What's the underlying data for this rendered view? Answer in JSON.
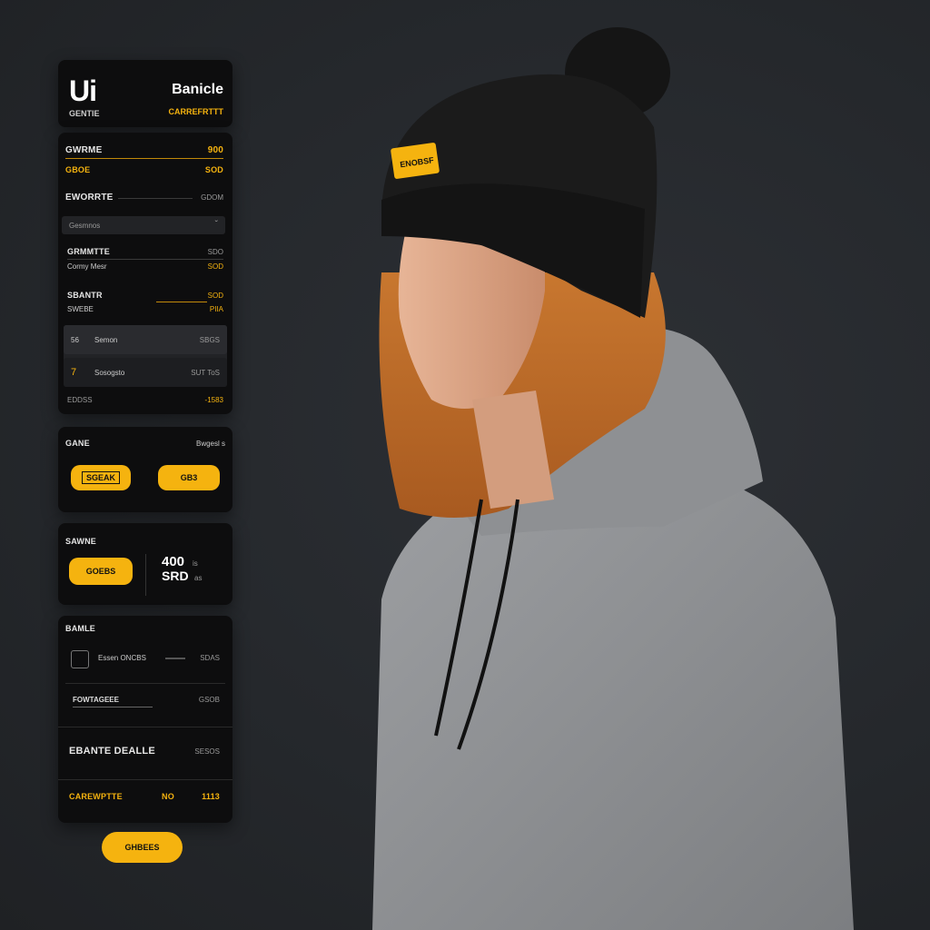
{
  "header": {
    "logo": "Ui",
    "logo_sub": "GENTIE",
    "title": "Banicle",
    "subtitle": "CARREFRTTT"
  },
  "list": {
    "r1": {
      "label": "GWRME",
      "value": "900"
    },
    "r2": {
      "label": "GBOE",
      "value": "SOD"
    },
    "r3": {
      "label": "EWORRTE",
      "value": "GDOM"
    },
    "search": {
      "placeholder": "Gesmnos",
      "icon_text": "ˇ"
    },
    "r4": {
      "label": "GRMMTTE",
      "value": "SDO",
      "sub_label": "Cormy Mesr",
      "sub_value": "SOD"
    },
    "r5": {
      "label": "SBANTR",
      "value": "SOD",
      "sub_label": "SWEBE",
      "sub_value": "PIIA"
    },
    "item1": {
      "num": "56",
      "label": "Semon",
      "value": "SBGS"
    },
    "item2": {
      "num": "7",
      "label": "Sosogsto",
      "value": "SUT ToS"
    },
    "footer": {
      "label": "EDDSS",
      "value": "-1583"
    }
  },
  "card2": {
    "title": "GANE",
    "right": "Bwgesl s",
    "btn1": "SGEAK",
    "btn2": "GB3"
  },
  "card3": {
    "title": "SAWNE",
    "btn": "GOEBS",
    "value_top": "400",
    "value_top_unit": "is",
    "value_bottom": "SRD",
    "value_bottom_unit": "as"
  },
  "card4": {
    "title": "BAMLE",
    "rows": [
      {
        "label": "Essen ONCBS",
        "value": "SDAS"
      },
      {
        "label": "FOWTAGEEE",
        "value": "GSOB"
      },
      {
        "label": "EBANTE DEALLE",
        "value": "SESOS"
      }
    ],
    "footer": {
      "label": "CAREWPTTE",
      "mid": "NO",
      "right": "1113"
    }
  },
  "bottom_button": "GHBEES",
  "hat_tag": "ENOBSF",
  "colors": {
    "accent": "#f5b30f",
    "panel": "#0d0d0e",
    "background": "#25282c"
  }
}
